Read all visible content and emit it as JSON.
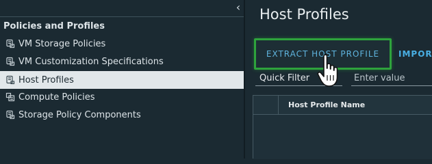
{
  "nav": {
    "collapse_icon": "chevron-left-icon",
    "header": "Policies and Profiles",
    "items": [
      {
        "label": "VM Storage Policies",
        "icon": "storage-policy-icon",
        "selected": false
      },
      {
        "label": "VM Customization Specifications",
        "icon": "customization-spec-icon",
        "selected": false
      },
      {
        "label": "Host Profiles",
        "icon": "host-profile-icon",
        "selected": true
      },
      {
        "label": "Compute Policies",
        "icon": "compute-policy-icon",
        "selected": false
      },
      {
        "label": "Storage Policy Components",
        "icon": "storage-component-icon",
        "selected": false
      }
    ]
  },
  "main": {
    "title": "Host Profiles",
    "actions": {
      "extract_label": "EXTRACT HOST PROFILE",
      "import_label": "IMPORT HOST PROFILE"
    },
    "filter": {
      "select_value": "Quick Filter",
      "input_placeholder": "Enter value"
    },
    "grid": {
      "columns": [
        "Host Profile Name"
      ]
    }
  },
  "colors": {
    "background": "#1b2a32",
    "selected_background": "#e1e7ea",
    "highlight_border": "#2ea33c",
    "link_blue": "#49afe3"
  },
  "cursor": "hand-pointer-icon"
}
